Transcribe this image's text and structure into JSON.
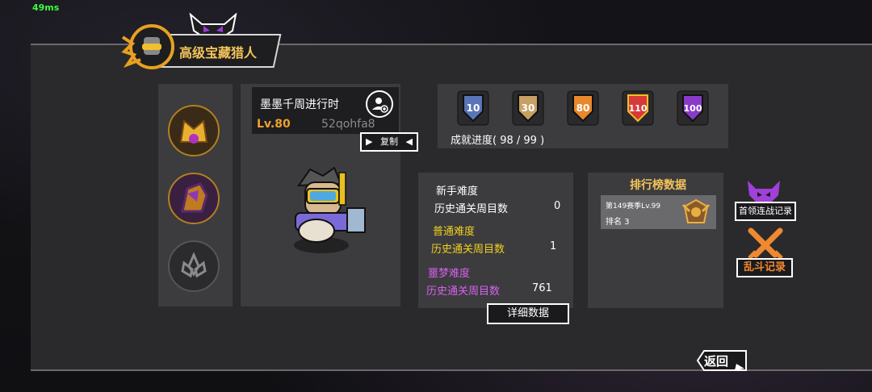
{
  "status": {
    "fps": "49ms"
  },
  "header": {
    "title": "高级宝藏猎人"
  },
  "player": {
    "name": "墨墨千周进行时",
    "level": "Lv.80",
    "id": "52qohfa8",
    "copy_label": "复制"
  },
  "achievements": {
    "medals": [
      {
        "value": "10",
        "color": "#5a74b8"
      },
      {
        "value": "30",
        "color": "#c8a064"
      },
      {
        "value": "80",
        "color": "#e8882a"
      },
      {
        "value": "110",
        "color": "#d83a3a"
      },
      {
        "value": "100",
        "color": "#8a3ac8"
      }
    ],
    "progress_text": "成就进度( 98 / 99 )"
  },
  "difficulty": {
    "novice": {
      "title": "新手难度",
      "label": "历史通关周目数",
      "value": "0"
    },
    "normal": {
      "title": "普通难度",
      "label": "历史通关周目数",
      "value": "1"
    },
    "nightmare": {
      "title": "噩梦难度",
      "label": "历史通关周目数",
      "value": "761"
    },
    "detail_button": "详细数据"
  },
  "ranking": {
    "title": "排行榜数据",
    "season": "第149赛季Lv.99",
    "rank": "排名 3"
  },
  "side_buttons": {
    "boss_record": "首领连战记录",
    "brawl_record": "乱斗记录"
  },
  "footer": {
    "back_label": "返回"
  }
}
